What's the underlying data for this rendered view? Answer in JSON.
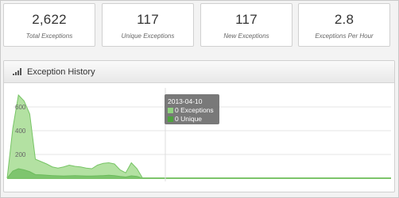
{
  "stats": [
    {
      "value": "2,622",
      "label": "Total Exceptions"
    },
    {
      "value": "117",
      "label": "Unique Exceptions"
    },
    {
      "value": "117",
      "label": "New Exceptions"
    },
    {
      "value": "2.8",
      "label": "Exceptions Per Hour"
    }
  ],
  "panel": {
    "title": "Exception History",
    "icon": "bar-chart-icon"
  },
  "tooltip": {
    "date": "2013-04-10",
    "rows": [
      {
        "label": "0 Exceptions",
        "color": "#8fd37e"
      },
      {
        "label": "0 Unique",
        "color": "#4ea33f"
      }
    ]
  },
  "colors": {
    "exceptions_fill": "#a6dc92",
    "exceptions_line": "#77c465",
    "unique_fill": "#6cbb5c",
    "baseline": "#7cc46a"
  },
  "chart_data": {
    "type": "area",
    "y_ticks": [
      "600",
      "400",
      "200"
    ],
    "ylim": [
      0,
      760
    ],
    "grid": true,
    "series": [
      {
        "name": "Exceptions",
        "values": [
          0,
          420,
          700,
          650,
          540,
          160,
          140,
          120,
          95,
          85,
          95,
          110,
          100,
          95,
          85,
          80,
          110,
          125,
          130,
          120,
          70,
          45,
          130,
          80,
          0,
          0,
          0,
          0,
          0,
          0,
          0,
          0,
          0,
          0,
          0,
          0,
          0,
          0,
          0,
          0,
          0,
          0,
          0,
          0,
          0,
          0,
          0,
          0,
          0,
          0,
          0,
          0,
          0,
          0,
          0,
          0,
          0,
          0,
          0,
          0,
          0,
          0,
          0,
          0,
          0,
          0,
          0,
          0,
          0
        ]
      },
      {
        "name": "Unique",
        "values": [
          0,
          60,
          80,
          70,
          55,
          30,
          28,
          25,
          22,
          20,
          18,
          20,
          22,
          20,
          18,
          18,
          20,
          22,
          25,
          22,
          15,
          10,
          20,
          15,
          0,
          0,
          0,
          0,
          0,
          0,
          0,
          0,
          0,
          0,
          0,
          0,
          0,
          0,
          0,
          0,
          0,
          0,
          0,
          0,
          0,
          0,
          0,
          0,
          0,
          0,
          0,
          0,
          0,
          0,
          0,
          0,
          0,
          0,
          0,
          0,
          0,
          0,
          0,
          0,
          0,
          0,
          0,
          0,
          0
        ]
      }
    ]
  }
}
